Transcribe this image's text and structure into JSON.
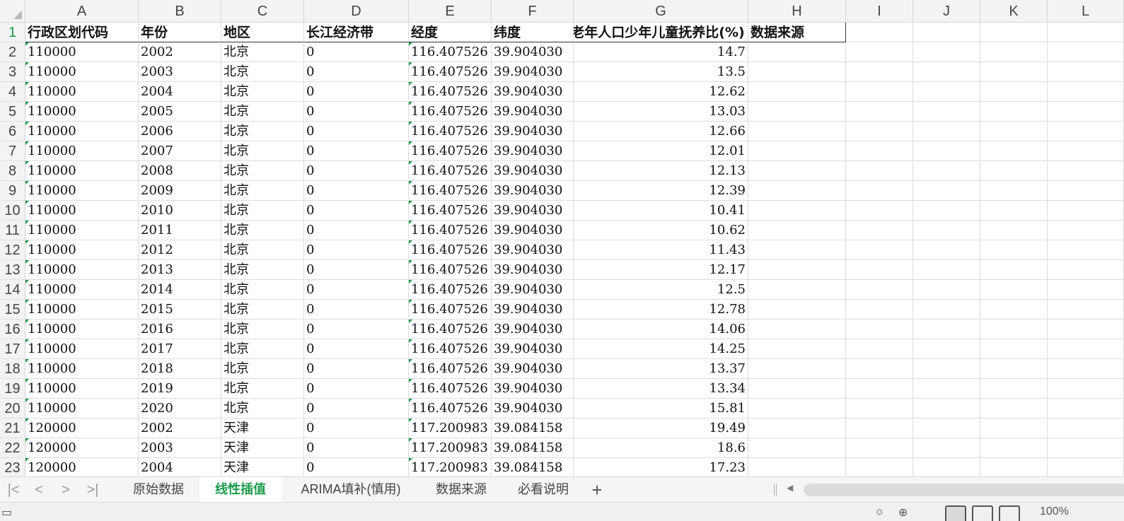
{
  "columns": [
    "A",
    "B",
    "C",
    "D",
    "E",
    "F",
    "G",
    "H",
    "I",
    "J",
    "K",
    "L"
  ],
  "header_row": [
    "行政区划代码",
    "年份",
    "地区",
    "长江经济带",
    "经度",
    "纬度",
    "老年人口少年儿童抚养比(%)",
    "数据来源"
  ],
  "rows": [
    [
      "110000",
      "2002",
      "北京",
      "0",
      "116.407526",
      "39.904030",
      "14.7"
    ],
    [
      "110000",
      "2003",
      "北京",
      "0",
      "116.407526",
      "39.904030",
      "13.5"
    ],
    [
      "110000",
      "2004",
      "北京",
      "0",
      "116.407526",
      "39.904030",
      "12.62"
    ],
    [
      "110000",
      "2005",
      "北京",
      "0",
      "116.407526",
      "39.904030",
      "13.03"
    ],
    [
      "110000",
      "2006",
      "北京",
      "0",
      "116.407526",
      "39.904030",
      "12.66"
    ],
    [
      "110000",
      "2007",
      "北京",
      "0",
      "116.407526",
      "39.904030",
      "12.01"
    ],
    [
      "110000",
      "2008",
      "北京",
      "0",
      "116.407526",
      "39.904030",
      "12.13"
    ],
    [
      "110000",
      "2009",
      "北京",
      "0",
      "116.407526",
      "39.904030",
      "12.39"
    ],
    [
      "110000",
      "2010",
      "北京",
      "0",
      "116.407526",
      "39.904030",
      "10.41"
    ],
    [
      "110000",
      "2011",
      "北京",
      "0",
      "116.407526",
      "39.904030",
      "10.62"
    ],
    [
      "110000",
      "2012",
      "北京",
      "0",
      "116.407526",
      "39.904030",
      "11.43"
    ],
    [
      "110000",
      "2013",
      "北京",
      "0",
      "116.407526",
      "39.904030",
      "12.17"
    ],
    [
      "110000",
      "2014",
      "北京",
      "0",
      "116.407526",
      "39.904030",
      "12.5"
    ],
    [
      "110000",
      "2015",
      "北京",
      "0",
      "116.407526",
      "39.904030",
      "12.78"
    ],
    [
      "110000",
      "2016",
      "北京",
      "0",
      "116.407526",
      "39.904030",
      "14.06"
    ],
    [
      "110000",
      "2017",
      "北京",
      "0",
      "116.407526",
      "39.904030",
      "14.25"
    ],
    [
      "110000",
      "2018",
      "北京",
      "0",
      "116.407526",
      "39.904030",
      "13.37"
    ],
    [
      "110000",
      "2019",
      "北京",
      "0",
      "116.407526",
      "39.904030",
      "13.34"
    ],
    [
      "110000",
      "2020",
      "北京",
      "0",
      "116.407526",
      "39.904030",
      "15.81"
    ],
    [
      "120000",
      "2002",
      "天津",
      "0",
      "117.200983",
      "39.084158",
      "19.49"
    ],
    [
      "120000",
      "2003",
      "天津",
      "0",
      "117.200983",
      "39.084158",
      "18.6"
    ],
    [
      "120000",
      "2004",
      "天津",
      "0",
      "117.200983",
      "39.084158",
      "17.23"
    ]
  ],
  "sheet_tabs": [
    {
      "label": "原始数据",
      "active": false
    },
    {
      "label": "线性插值",
      "active": true
    },
    {
      "label": "ARIMA填补(慎用)",
      "active": false
    },
    {
      "label": "数据来源",
      "active": false
    },
    {
      "label": "必看说明",
      "active": false
    }
  ],
  "tab_nav": [
    "|<",
    "<",
    ">",
    ">|"
  ],
  "add_sheet": "+",
  "status": {
    "zoom": "100%"
  },
  "colors": {
    "accent": "#1a9a4b"
  }
}
